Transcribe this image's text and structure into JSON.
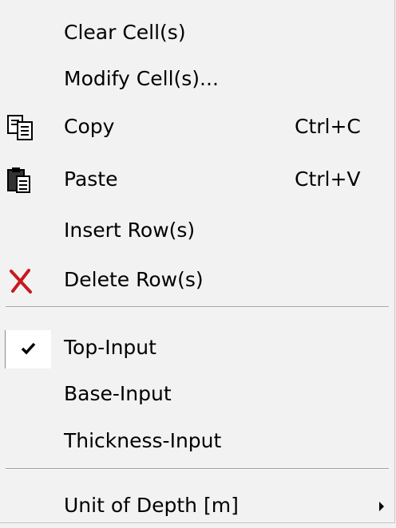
{
  "menu": {
    "items": [
      {
        "label": "Clear Cell(s)"
      },
      {
        "label": "Modify Cell(s)..."
      },
      {
        "label": "Copy",
        "shortcut": "Ctrl+C",
        "icon": "copy-icon"
      },
      {
        "label": "Paste",
        "shortcut": "Ctrl+V",
        "icon": "paste-icon"
      },
      {
        "label": "Insert Row(s)"
      },
      {
        "label": "Delete Row(s)",
        "icon": "delete-x-icon"
      },
      {
        "label": "Top-Input",
        "checked": true,
        "icon": "checkmark-icon"
      },
      {
        "label": "Base-Input"
      },
      {
        "label": "Thickness-Input"
      },
      {
        "label": "Unit of Depth [m]",
        "icon": "submenu-arrow-icon"
      }
    ]
  },
  "colors": {
    "menu_background": "#f2f2f2",
    "separator": "#a0a0a0",
    "delete_icon": "#c8191e",
    "check_background": "#ffffff"
  }
}
